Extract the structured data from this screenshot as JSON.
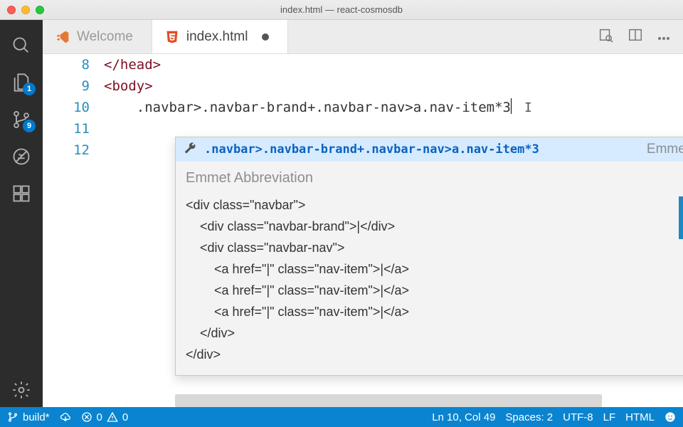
{
  "window": {
    "title": "index.html — react-cosmosdb"
  },
  "activity": {
    "explorer_badge": "1",
    "scm_badge": "9"
  },
  "tabs": {
    "welcome": "Welcome",
    "index": "index.html"
  },
  "editor": {
    "line_numbers": [
      "8",
      "9",
      "10",
      "11",
      "12"
    ],
    "line8_open": "</",
    "line8_tag": "head",
    "line8_close": ">",
    "line9_open": "<",
    "line9_tag": "body",
    "line9_close": ">",
    "line10": ".navbar>.navbar-brand+.navbar-nav>a.nav-item*3"
  },
  "suggest": {
    "abbr": ".navbar>.navbar-brand+.navbar-nav>a.nav-item*3",
    "hint": "Emmet A…",
    "detail_title": "Emmet Abbreviation",
    "preview": "<div class=\"navbar\">\n    <div class=\"navbar-brand\">|</div>\n    <div class=\"navbar-nav\">\n        <a href=\"|\" class=\"nav-item\">|</a>\n        <a href=\"|\" class=\"nav-item\">|</a>\n        <a href=\"|\" class=\"nav-item\">|</a>\n    </div>\n</div>"
  },
  "status": {
    "branch": "build*",
    "errors": "0",
    "warnings": "0",
    "position": "Ln 10, Col 49",
    "spaces": "Spaces: 2",
    "encoding": "UTF-8",
    "eol": "LF",
    "lang": "HTML"
  }
}
